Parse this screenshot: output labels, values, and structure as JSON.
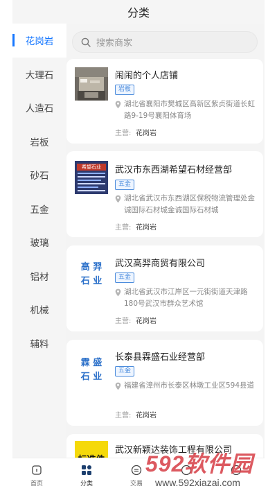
{
  "header": {
    "title": "分类"
  },
  "sidebar": {
    "items": [
      {
        "label": "花岗岩"
      },
      {
        "label": "大理石"
      },
      {
        "label": "人造石"
      },
      {
        "label": "岩板"
      },
      {
        "label": "砂石"
      },
      {
        "label": "五金"
      },
      {
        "label": "玻璃"
      },
      {
        "label": "铝材"
      },
      {
        "label": "机械"
      },
      {
        "label": "辅料"
      }
    ]
  },
  "search": {
    "placeholder": "搜索商家"
  },
  "merchants": [
    {
      "name": "闹闹的个人店铺",
      "tag": "岩板",
      "address": "湖北省襄阳市樊城区高新区紫贞街道长虹路9-19号襄阳体育场",
      "main_label": "主营:",
      "main_value": "花岗岩"
    },
    {
      "name": "武汉市东西湖希望石材经营部",
      "tag": "五金",
      "logo_text": "希望石业",
      "address": "湖北省武汉市东西湖区保税物流管理处金诚国际石材城金诚国际石材城",
      "main_label": "主营:",
      "main_value": "花岗岩"
    },
    {
      "name": "武汉高羿商贸有限公司",
      "tag": "五金",
      "logo_text_1": "高 羿",
      "logo_text_2": "石 业",
      "address": "湖北省武汉市江岸区一元街街道天津路180号武汉市群众艺术馆",
      "main_label": "主营:",
      "main_value": "花岗岩"
    },
    {
      "name": "长泰县霖盛石业经营部",
      "tag": "五金",
      "logo_text_1": "霖 盛",
      "logo_text_2": "石 业",
      "address": "福建省漳州市长泰区林墩工业区594县道",
      "main_label": "主营:",
      "main_value": "花岗岩"
    },
    {
      "name": "武汉新颖达装饰工程有限公司",
      "logo_text": "标准件"
    }
  ],
  "tabbar": {
    "items": [
      {
        "label": "首页"
      },
      {
        "label": "分类"
      },
      {
        "label": "交易"
      },
      {
        "label": ""
      },
      {
        "label": ""
      }
    ]
  },
  "watermark": {
    "logo": "592软件园",
    "url": "www.592xiazai.com"
  },
  "colors": {
    "accent": "#1677ff",
    "tag": "#4a8bdc",
    "logo_blue": "#2a6fc9"
  }
}
